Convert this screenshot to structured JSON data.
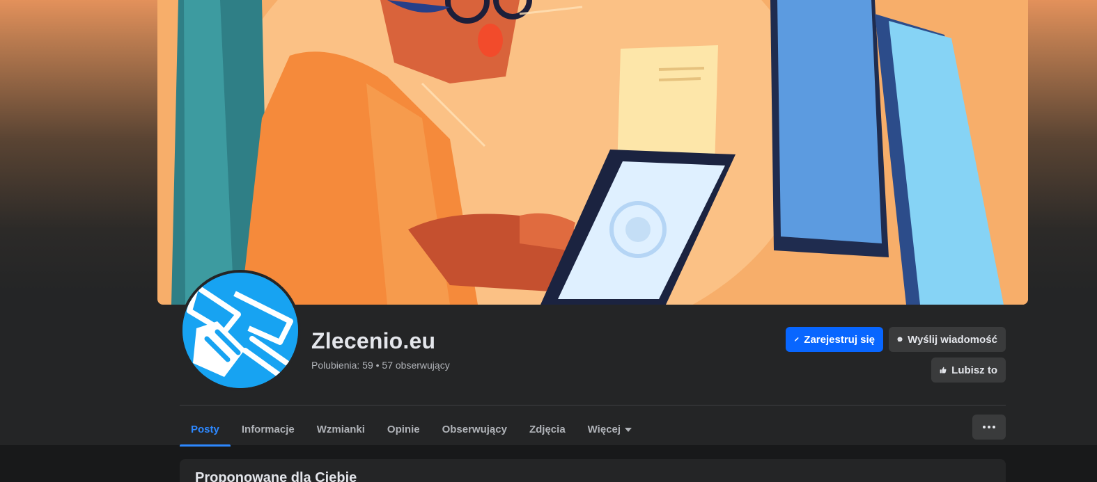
{
  "page": {
    "name": "Zlecenio.eu",
    "stats": "Polubienia: 59 • 57 obserwujący"
  },
  "actions": {
    "register_label": "Zarejestruj się",
    "message_label": "Wyślij wiadomość",
    "like_label": "Lubisz to"
  },
  "tabs": [
    {
      "label": "Posty",
      "active": true
    },
    {
      "label": "Informacje",
      "active": false
    },
    {
      "label": "Wzmianki",
      "active": false
    },
    {
      "label": "Opinie",
      "active": false
    },
    {
      "label": "Obserwujący",
      "active": false
    },
    {
      "label": "Zdjęcia",
      "active": false
    },
    {
      "label": "Więcej",
      "active": false
    }
  ],
  "suggestions": {
    "title": "Proponowane dla Ciebie"
  },
  "icons": {
    "register": "pencil-icon",
    "message": "messenger-icon",
    "like": "thumbs-up-icon",
    "more": "ellipsis-icon",
    "more_tab": "caret-down-icon"
  },
  "colors": {
    "accent": "#0866ff",
    "active_tab": "#2d88ff",
    "surface": "#242526",
    "background": "#18191a"
  }
}
